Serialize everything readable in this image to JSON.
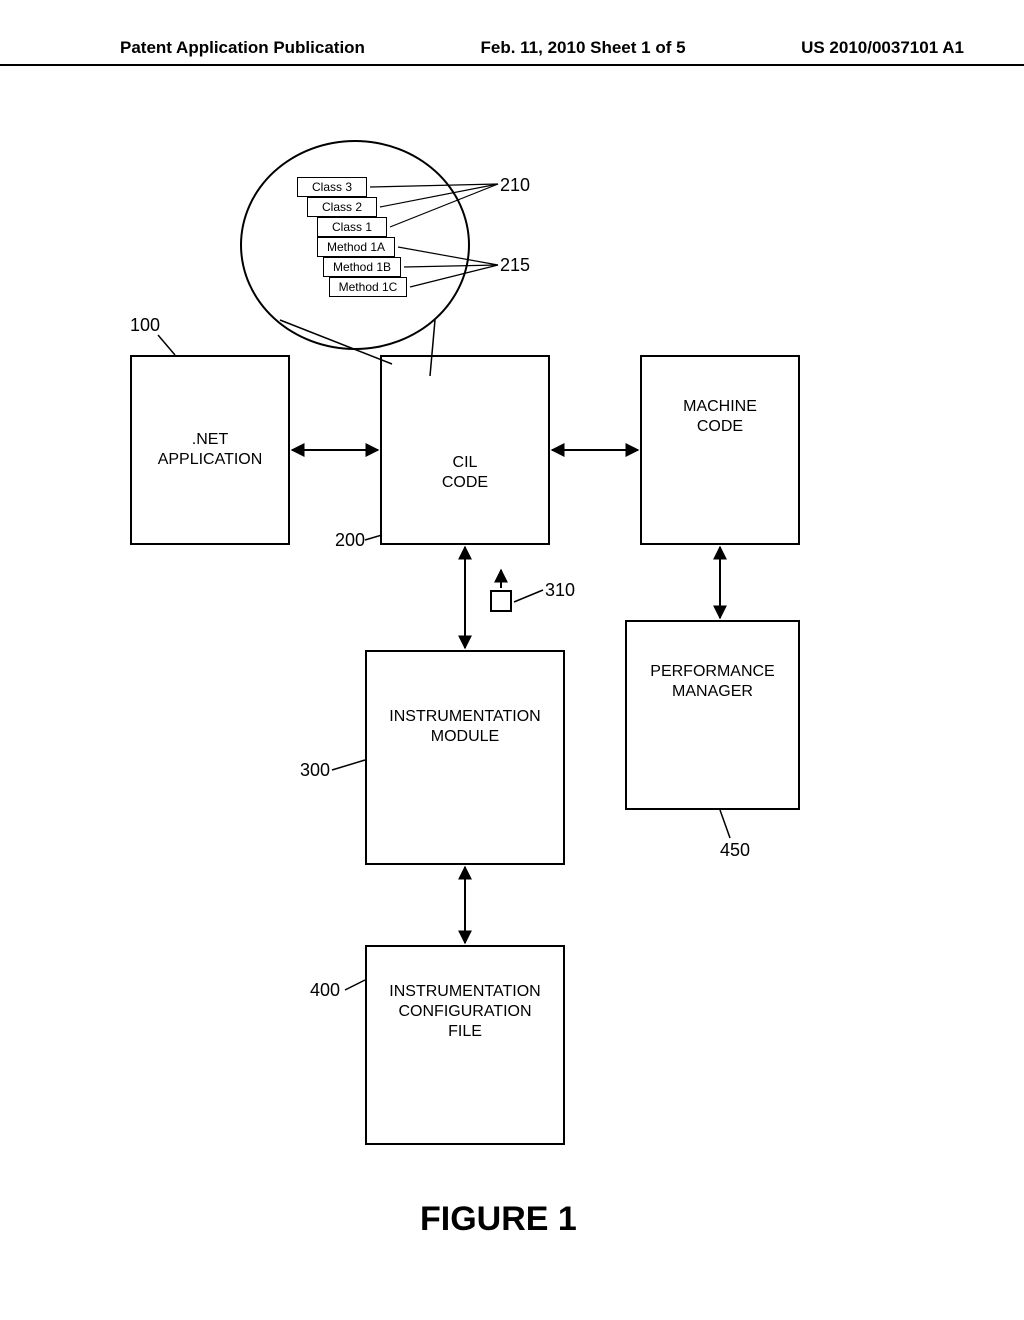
{
  "header": {
    "left": "Patent Application Publication",
    "mid": "Feb. 11, 2010  Sheet 1 of 5",
    "right": "US 2010/0037101 A1"
  },
  "boxes": {
    "net_app": ".NET\nAPPLICATION",
    "cil_code": "CIL\nCODE",
    "machine_code": "MACHINE\nCODE",
    "instr_module": "INSTRUMENTATION\nMODULE",
    "perf_mgr": "PERFORMANCE\nMANAGER",
    "config_file": "INSTRUMENTATION\nCONFIGURATION\nFILE"
  },
  "classes": {
    "c3": "Class 3",
    "c2": "Class 2",
    "c1": "Class 1",
    "m1a": "Method 1A",
    "m1b": "Method 1B",
    "m1c": "Method 1C"
  },
  "refs": {
    "r100": "100",
    "r200": "200",
    "r210": "210",
    "r215": "215",
    "r300": "300",
    "r310": "310",
    "r400": "400",
    "r450": "450"
  },
  "caption": "FIGURE 1"
}
